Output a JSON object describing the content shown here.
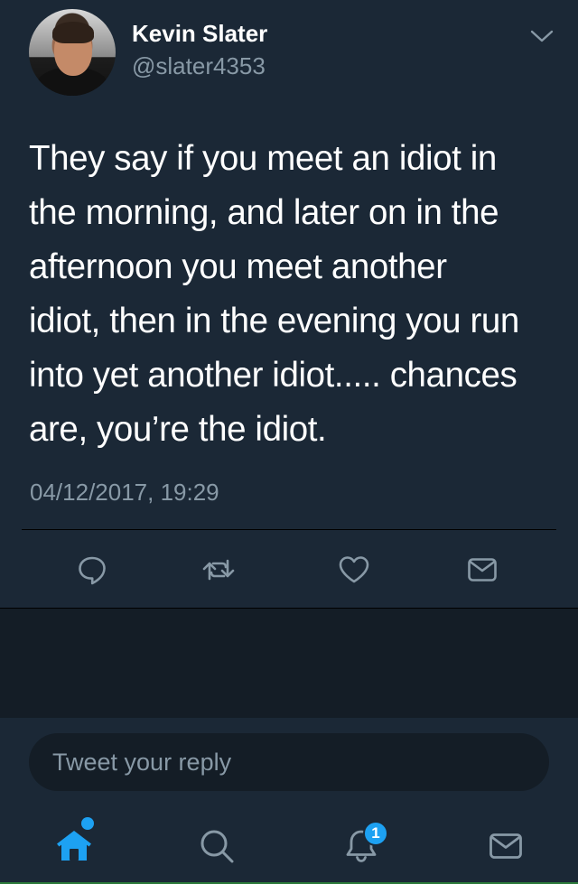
{
  "tweet": {
    "author_name": "Kevin Slater",
    "author_handle": "@slater4353",
    "lines": [
      "They say if you meet an idiot in",
      "the morning, and later on in the",
      "afternoon you meet another",
      "idiot, then in the evening you run",
      "into yet another idiot..... chances",
      "are, you’re the idiot."
    ],
    "timestamp": "04/12/2017, 19:29"
  },
  "actions": [
    "reply-icon",
    "retweet-icon",
    "like-icon",
    "direct-message-icon"
  ],
  "composer": {
    "placeholder": "Tweet your reply"
  },
  "tabbar": {
    "tabs": [
      "home-icon",
      "search-icon",
      "notifications-icon",
      "messages-icon"
    ],
    "notification_count": "1"
  },
  "colors": {
    "background": "#1b2836",
    "secondary_text": "#8899a6",
    "accent": "#1da1f2",
    "icon": "#8899a6"
  }
}
